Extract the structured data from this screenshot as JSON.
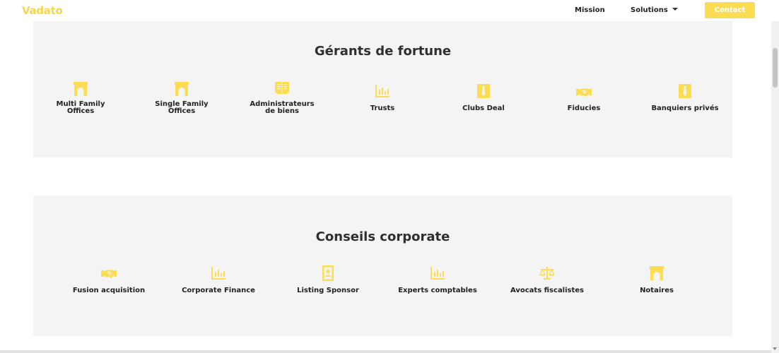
{
  "header": {
    "logo": "Vadato",
    "nav": {
      "mission": "Mission",
      "solutions": "Solutions"
    },
    "contact": "Contact"
  },
  "colors": {
    "accent": "#fbdc52",
    "panel_bg": "#f4f4f4",
    "text": "#2b2b2b"
  },
  "sections": [
    {
      "title": "Gérants de fortune",
      "items": [
        {
          "label": "Multi Family\nOffices",
          "icon": "archway-icon"
        },
        {
          "label": "Single Family\nOffices",
          "icon": "archway-icon"
        },
        {
          "label": "Administrateurs\nde biens",
          "icon": "book-icon"
        },
        {
          "label": "Trusts",
          "icon": "bar-chart-icon"
        },
        {
          "label": "Clubs Deal",
          "icon": "tie-card-icon"
        },
        {
          "label": "Fiducies",
          "icon": "handshake-icon"
        },
        {
          "label": "Banquiers privés",
          "icon": "tie-card-icon"
        }
      ]
    },
    {
      "title": "Conseils corporate",
      "items": [
        {
          "label": "Fusion acquisition",
          "icon": "handshake-icon"
        },
        {
          "label": "Corporate Finance",
          "icon": "bar-chart-icon"
        },
        {
          "label": "Listing Sponsor",
          "icon": "id-card-icon"
        },
        {
          "label": "Experts comptables",
          "icon": "bar-chart-icon"
        },
        {
          "label": "Avocats fiscalistes",
          "icon": "scales-icon"
        },
        {
          "label": "Notaires",
          "icon": "archway-icon"
        }
      ]
    }
  ]
}
